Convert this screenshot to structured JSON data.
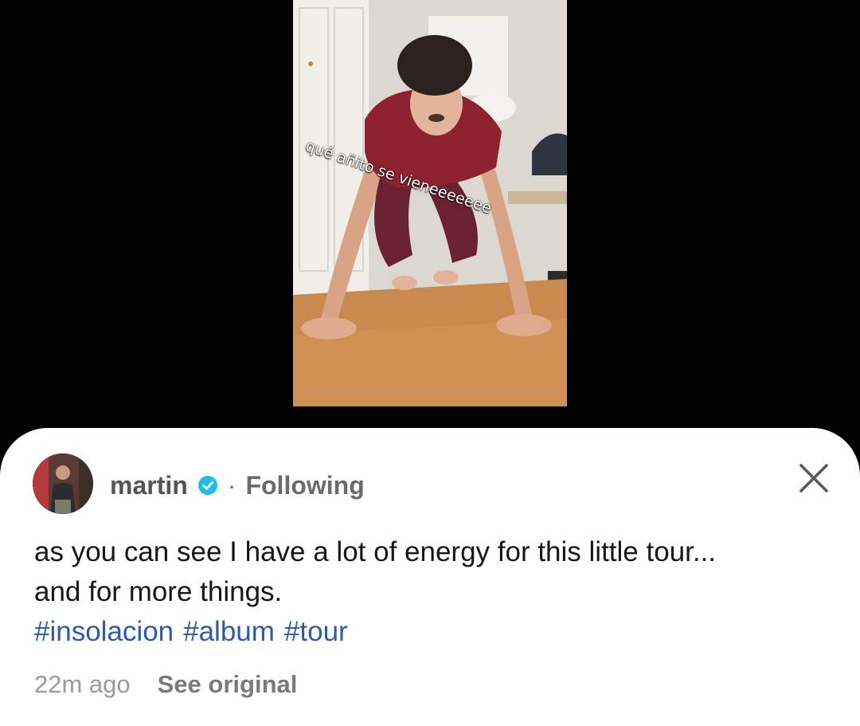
{
  "video": {
    "overlay_text": "qué añito se vieneeeeeee"
  },
  "post": {
    "author": "martin",
    "separator": "·",
    "follow_status": "Following",
    "caption_line1": "as you can see I have a lot of energy for this little tour...",
    "caption_line2": "and for more things.",
    "hashtags": [
      "#insolacion",
      "#album",
      "#tour"
    ],
    "time_ago": "22m ago",
    "see_original_label": "See original"
  },
  "colors": {
    "hashtag": "#2e5aa8",
    "verified": "#20bde6"
  }
}
